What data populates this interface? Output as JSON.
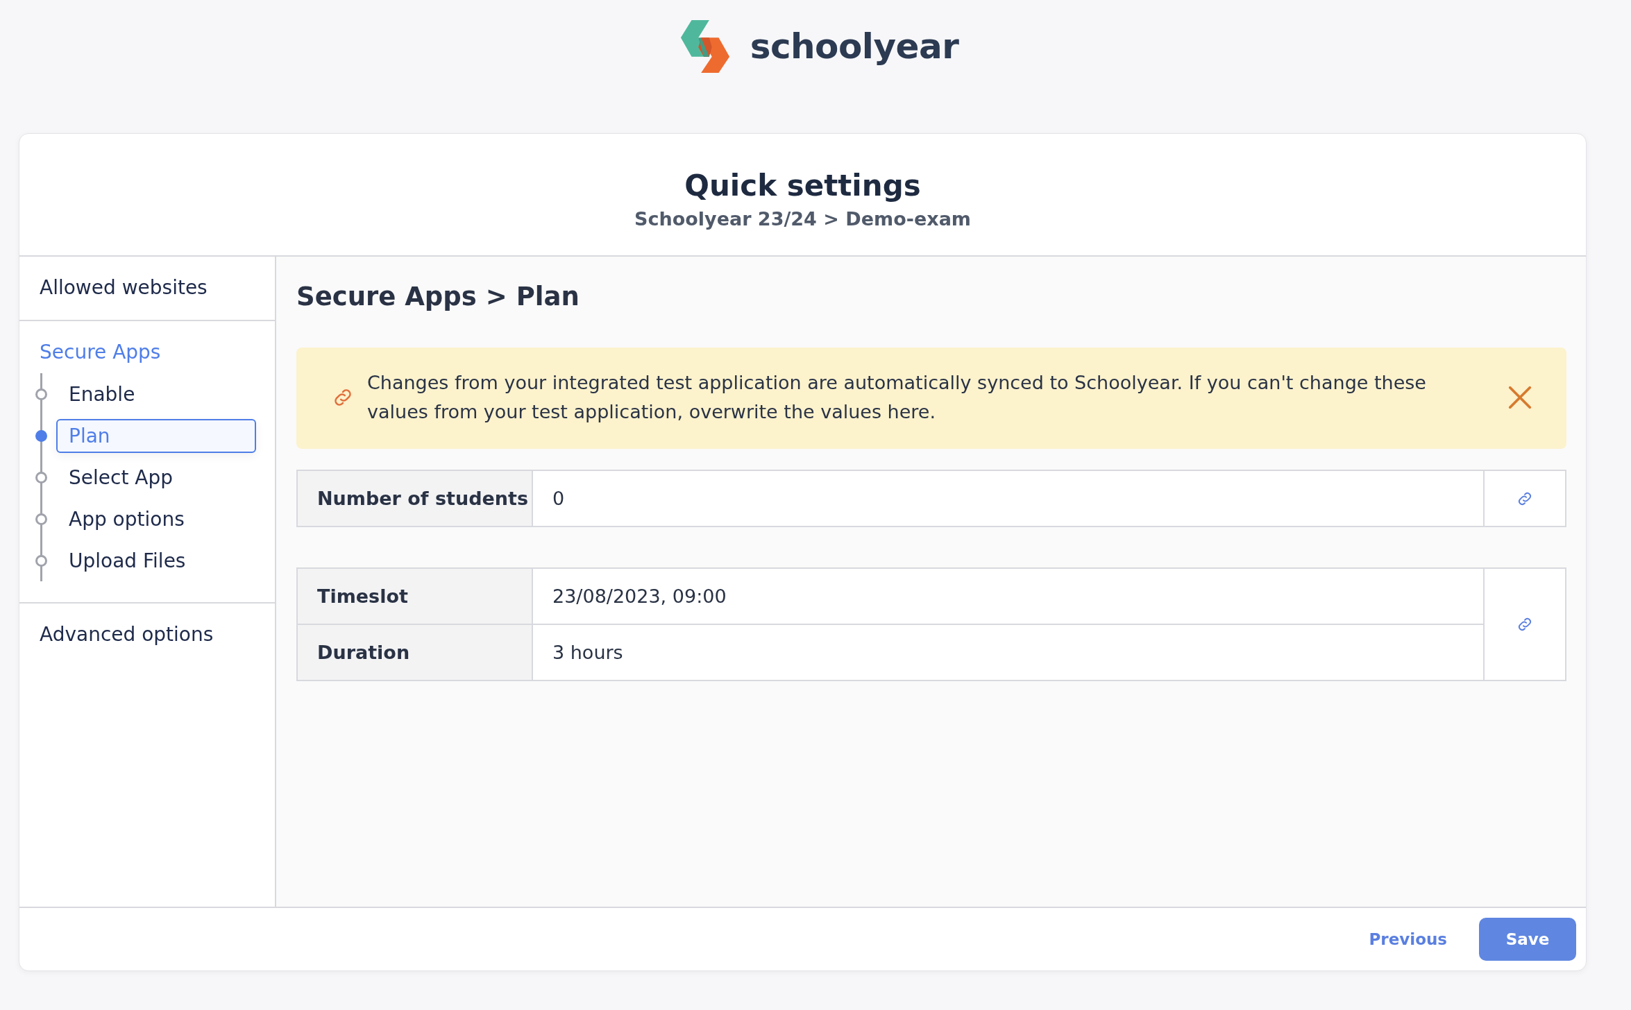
{
  "logo": {
    "text": "schoolyear"
  },
  "card": {
    "title": "Quick settings",
    "breadcrumb": "Schoolyear 23/24 > Demo-exam"
  },
  "sidebar": {
    "sections": [
      {
        "label": "Allowed websites",
        "selected": false
      },
      {
        "label": "Secure Apps",
        "selected": true,
        "children": [
          {
            "label": "Enable",
            "selected": false
          },
          {
            "label": "Plan",
            "selected": true
          },
          {
            "label": "Select App",
            "selected": false
          },
          {
            "label": "App options",
            "selected": false
          },
          {
            "label": "Upload Files",
            "selected": false
          }
        ]
      },
      {
        "label": "Advanced options",
        "selected": false
      }
    ]
  },
  "content": {
    "heading": "Secure Apps > Plan",
    "notice": {
      "text": "Changes from your integrated test application are automatically synced to Schoolyear. If you can't change these values from your test application, overwrite the values here."
    },
    "field_groups": [
      {
        "fields": [
          {
            "label": "Number of students",
            "value": "0"
          }
        ]
      },
      {
        "fields": [
          {
            "label": "Timeslot",
            "value": "23/08/2023, 09:00"
          },
          {
            "label": "Duration",
            "value": "3 hours"
          }
        ]
      }
    ]
  },
  "footer": {
    "buttons": [
      {
        "label": "Previous",
        "kind": "link"
      },
      {
        "label": "Save",
        "kind": "primary"
      }
    ]
  }
}
